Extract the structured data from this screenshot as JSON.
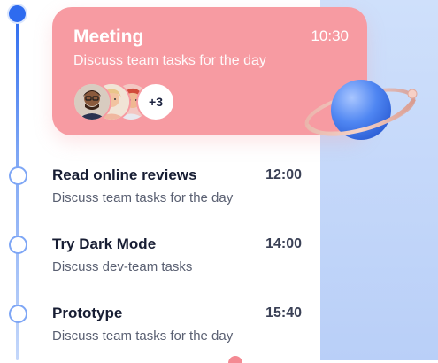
{
  "meeting": {
    "title": "Meeting",
    "time": "10:30",
    "description": "Discuss team tasks for the day",
    "more_participants": "+3",
    "colors": {
      "card": "#f79ba2"
    }
  },
  "tasks": [
    {
      "title": "Read online reviews",
      "time": "12:00",
      "description": "Discuss team tasks for the day"
    },
    {
      "title": "Try Dark Mode",
      "time": "14:00",
      "description": "Discuss dev-team tasks"
    },
    {
      "title": "Prototype",
      "time": "15:40",
      "description": "Discuss team tasks for the day"
    }
  ],
  "colors": {
    "accent": "#2e6bef",
    "timeline_dot": "#7ea6f5",
    "side_background": "#c4d7fa"
  },
  "icons": [
    "avatar-1",
    "avatar-2",
    "avatar-3",
    "planet-illustration"
  ]
}
